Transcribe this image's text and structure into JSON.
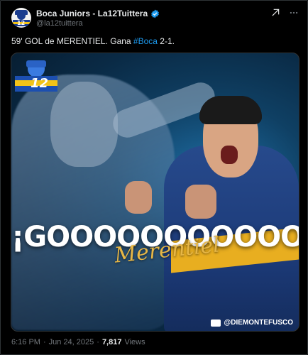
{
  "tweet": {
    "display_name": "Boca Juniors - La12Tuittera",
    "handle": "@la12tuittera",
    "text_before": "59' GOL de MERENTIEL. Gana ",
    "hashtag": "#Boca",
    "text_after": " 2-1.",
    "time": "6:16 PM",
    "separator": "·",
    "date": "Jun 24, 2025",
    "views_count": "7,817",
    "views_label": "Views"
  },
  "media": {
    "logo_number": "12",
    "headline": "¡GOOOOOOOOOOOL!",
    "signature": "Merentiel",
    "credit": "@DIEMONTEFUSCO"
  },
  "icons": {
    "verified": "verified-badge-icon",
    "grok": "grok-icon",
    "more": "more-options-icon",
    "camera": "image-credit-icon"
  },
  "colors": {
    "background": "#000000",
    "hashtag": "#1d9bf0",
    "verified": "#1d9bf0",
    "secondary_text": "#71767b"
  }
}
